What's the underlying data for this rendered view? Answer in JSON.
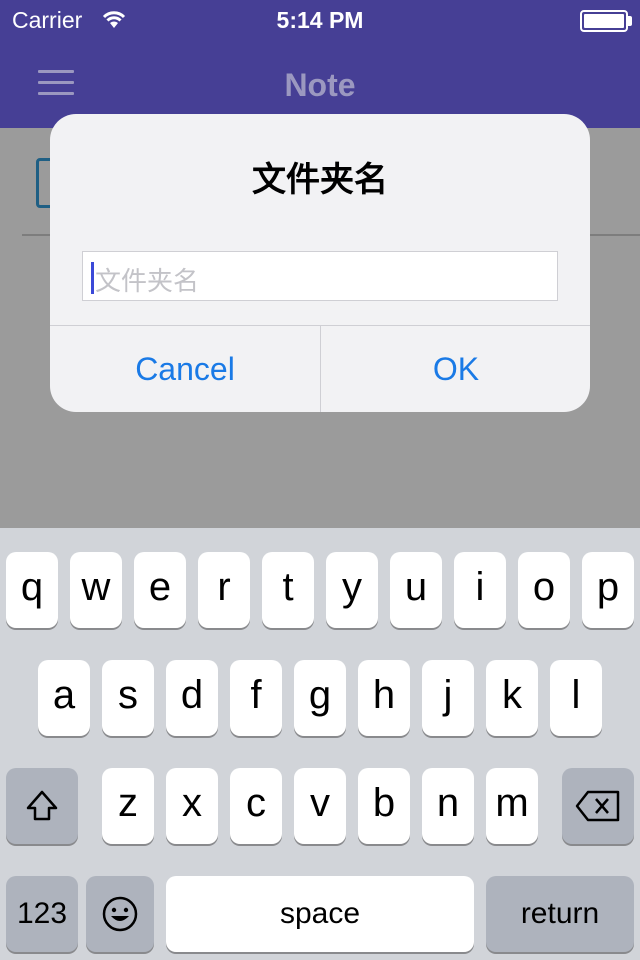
{
  "status_bar": {
    "carrier": "Carrier",
    "time": "5:14 PM"
  },
  "navbar": {
    "title": "Note",
    "menu_icon": "hamburger-menu-icon"
  },
  "list": {
    "item_icon": "document-icon"
  },
  "dialog": {
    "title": "文件夹名",
    "input_placeholder": "文件夹名",
    "input_value": "",
    "cancel_label": "Cancel",
    "ok_label": "OK",
    "button_color": "#1a7ae6"
  },
  "keyboard": {
    "row1": [
      "q",
      "w",
      "e",
      "r",
      "t",
      "y",
      "u",
      "i",
      "o",
      "p"
    ],
    "row2": [
      "a",
      "s",
      "d",
      "f",
      "g",
      "h",
      "j",
      "k",
      "l"
    ],
    "row3": [
      "z",
      "x",
      "c",
      "v",
      "b",
      "n",
      "m"
    ],
    "shift_icon": "shift-icon",
    "delete_icon": "backspace-icon",
    "numbers_label": "123",
    "emoji_icon": "emoji-icon",
    "space_label": "space",
    "return_label": "return"
  },
  "colors": {
    "navbar": "#463f95",
    "dim_background": "#9b9b9b",
    "keyboard_bg": "#d1d4d9"
  }
}
